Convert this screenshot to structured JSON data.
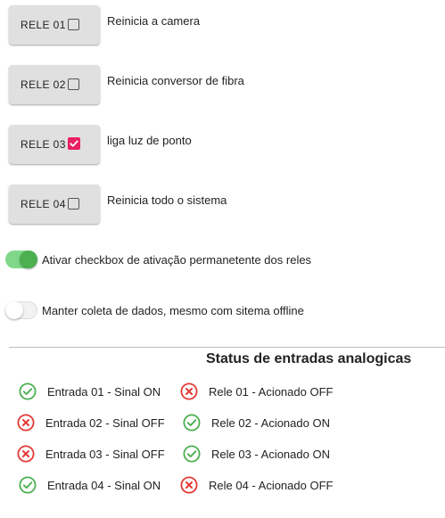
{
  "colors": {
    "ok": "#4caf50",
    "error": "#e53935",
    "checkbox_checked": "#e91e63",
    "switch_on_track": "#7fd88a",
    "switch_on_knob": "#4caf50"
  },
  "relays": [
    {
      "label": "RELE 01",
      "checked": false,
      "description": "Reinicia a camera"
    },
    {
      "label": "RELE 02",
      "checked": false,
      "description": "Reinicia conversor de fibra"
    },
    {
      "label": "RELE 03",
      "checked": true,
      "description": "liga luz de ponto"
    },
    {
      "label": "RELE 04",
      "checked": false,
      "description": "Reinicia todo o sistema"
    }
  ],
  "toggles": [
    {
      "label": "Ativar checkbox de ativação permanetente dos reles",
      "on": true
    },
    {
      "label": "Manter coleta de dados, mesmo com sitema offline",
      "on": false
    }
  ],
  "status": {
    "title": "Status de entradas analogicas",
    "inputs": [
      {
        "label": "Entrada 01 - Sinal ON",
        "state": "ok",
        "icon": "check-circle-icon"
      },
      {
        "label": "Entrada 02 - Sinal OFF",
        "state": "error",
        "icon": "x-circle-icon"
      },
      {
        "label": "Entrada 03 - Sinal OFF",
        "state": "error",
        "icon": "x-circle-icon"
      },
      {
        "label": "Entrada 04 - Sinal ON",
        "state": "ok",
        "icon": "check-circle-icon"
      }
    ],
    "relays": [
      {
        "label": "Rele 01 - Acionado OFF",
        "state": "error",
        "icon": "x-circle-icon"
      },
      {
        "label": "Rele 02 - Acionado ON",
        "state": "ok",
        "icon": "check-circle-icon"
      },
      {
        "label": "Rele 03 - Acionado ON",
        "state": "ok",
        "icon": "check-circle-icon"
      },
      {
        "label": "Rele 04 - Acionado OFF",
        "state": "error",
        "icon": "x-circle-icon"
      }
    ]
  }
}
